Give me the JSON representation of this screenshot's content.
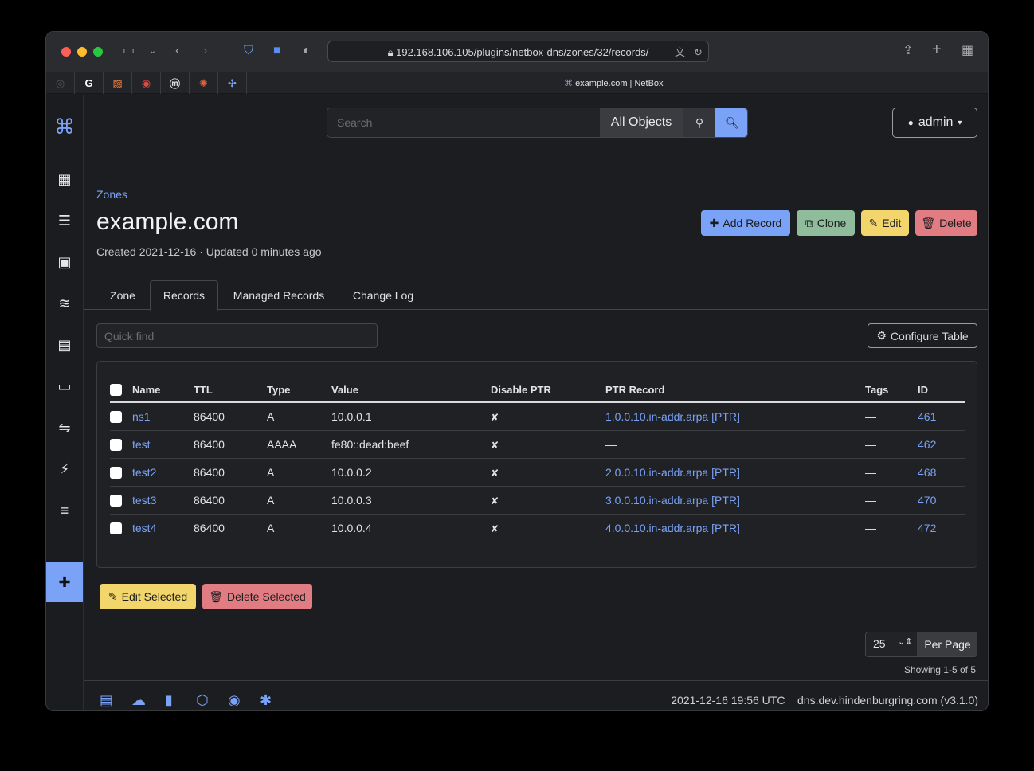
{
  "browser": {
    "url": "192.168.106.105/plugins/netbox-dns/zones/32/records/",
    "tab_title": "example.com | NetBox"
  },
  "header": {
    "search_placeholder": "Search",
    "scope": "All Objects",
    "user": "admin"
  },
  "page": {
    "breadcrumb": "Zones",
    "title": "example.com",
    "meta": "Created 2021-12-16 · Updated 0 minutes ago",
    "actions": {
      "add": "Add Record",
      "clone": "Clone",
      "edit": "Edit",
      "delete": "Delete"
    },
    "tabs": [
      "Zone",
      "Records",
      "Managed Records",
      "Change Log"
    ],
    "active_tab": "Records"
  },
  "table": {
    "quickfind_placeholder": "Quick find",
    "configure": "Configure Table",
    "columns": [
      "Name",
      "TTL",
      "Type",
      "Value",
      "Disable PTR",
      "PTR Record",
      "Tags",
      "ID"
    ],
    "rows": [
      {
        "name": "ns1",
        "ttl": "86400",
        "type": "A",
        "value": "10.0.0.1",
        "disable_ptr": "✘",
        "ptr": "1.0.0.10.in-addr.arpa [PTR]",
        "tags": "—",
        "id": "461"
      },
      {
        "name": "test",
        "ttl": "86400",
        "type": "AAAA",
        "value": "fe80::dead:beef",
        "disable_ptr": "✘",
        "ptr": "—",
        "tags": "—",
        "id": "462"
      },
      {
        "name": "test2",
        "ttl": "86400",
        "type": "A",
        "value": "10.0.0.2",
        "disable_ptr": "✘",
        "ptr": "2.0.0.10.in-addr.arpa [PTR]",
        "tags": "—",
        "id": "468"
      },
      {
        "name": "test3",
        "ttl": "86400",
        "type": "A",
        "value": "10.0.0.3",
        "disable_ptr": "✘",
        "ptr": "3.0.0.10.in-addr.arpa [PTR]",
        "tags": "—",
        "id": "470"
      },
      {
        "name": "test4",
        "ttl": "86400",
        "type": "A",
        "value": "10.0.0.4",
        "disable_ptr": "✘",
        "ptr": "4.0.0.10.in-addr.arpa [PTR]",
        "tags": "—",
        "id": "472"
      }
    ]
  },
  "bulk": {
    "edit": "Edit Selected",
    "delete": "Delete Selected"
  },
  "pagination": {
    "per_page_value": "25",
    "per_page_label": "Per Page",
    "showing": "Showing 1-5 of 5"
  },
  "footer": {
    "timestamp": "2021-12-16 19:56 UTC",
    "host": "dns.dev.hindenburgring.com (v3.1.0)"
  },
  "colors": {
    "accent": "#7aa2f7",
    "success": "#8fbc9b",
    "warning": "#f2d66b",
    "danger": "#e17c82"
  }
}
